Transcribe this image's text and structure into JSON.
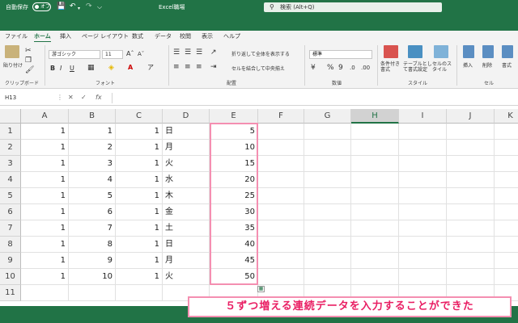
{
  "titlebar": {
    "autosave_label": "自動保存",
    "autosave_state": "オフ",
    "document_title": "Excel職場",
    "search_placeholder": "検索 (Alt+Q)"
  },
  "tabs": [
    "ファイル",
    "ホーム",
    "挿入",
    "ページ レイアウト",
    "数式",
    "データ",
    "校閲",
    "表示",
    "ヘルプ"
  ],
  "active_tab": "ホーム",
  "ribbon": {
    "clipboard": {
      "label": "クリップボード",
      "paste": "貼り付け"
    },
    "font": {
      "label": "フォント",
      "font_name": "游ゴシック",
      "font_size": "11"
    },
    "alignment": {
      "label": "配置",
      "wrap_text": "折り返して全体を表示する",
      "merge_center": "セルを結合して中央揃え"
    },
    "number": {
      "label": "数値",
      "format": "標準"
    },
    "styles": {
      "label": "スタイル",
      "conditional": "条件付き書式",
      "table": "テーブルとして書式設定",
      "cell_styles": "セルのスタイル"
    },
    "cells": {
      "label": "セル",
      "insert": "挿入",
      "delete": "削除",
      "format": "書式"
    }
  },
  "formula_bar": {
    "name_box": "H13",
    "fx": "fx"
  },
  "columns": [
    "A",
    "B",
    "C",
    "D",
    "E",
    "F",
    "G",
    "H",
    "I",
    "J",
    "K"
  ],
  "selected_column": "H",
  "rows": [
    {
      "n": "1",
      "A": "1",
      "B": "1",
      "C": "1",
      "D": "日",
      "E": "5"
    },
    {
      "n": "2",
      "A": "1",
      "B": "2",
      "C": "1",
      "D": "月",
      "E": "10"
    },
    {
      "n": "3",
      "A": "1",
      "B": "3",
      "C": "1",
      "D": "火",
      "E": "15"
    },
    {
      "n": "4",
      "A": "1",
      "B": "4",
      "C": "1",
      "D": "水",
      "E": "20"
    },
    {
      "n": "5",
      "A": "1",
      "B": "5",
      "C": "1",
      "D": "木",
      "E": "25"
    },
    {
      "n": "6",
      "A": "1",
      "B": "6",
      "C": "1",
      "D": "金",
      "E": "30"
    },
    {
      "n": "7",
      "A": "1",
      "B": "7",
      "C": "1",
      "D": "土",
      "E": "35"
    },
    {
      "n": "8",
      "A": "1",
      "B": "8",
      "C": "1",
      "D": "日",
      "E": "40"
    },
    {
      "n": "9",
      "A": "1",
      "B": "9",
      "C": "1",
      "D": "月",
      "E": "45"
    },
    {
      "n": "10",
      "A": "1",
      "B": "10",
      "C": "1",
      "D": "火",
      "E": "50"
    },
    {
      "n": "11",
      "A": "",
      "B": "",
      "C": "",
      "D": "",
      "E": ""
    }
  ],
  "callout": "５ずつ増える連続データを入力することができた",
  "colors": {
    "excel_green": "#217346",
    "highlight_pink": "#f48fb1",
    "callout_text": "#e91e63"
  }
}
